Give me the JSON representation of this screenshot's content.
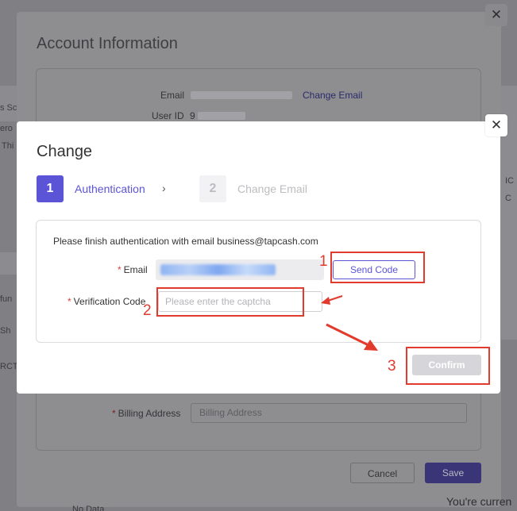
{
  "background": {
    "fragments": [
      "s Sc",
      "ero",
      "Thi",
      "fun",
      "Sh",
      "RCT",
      "IC",
      "C"
    ],
    "no_data": "No Data",
    "your_current": "You're curren"
  },
  "outer_modal": {
    "title": "Account Information",
    "email_label": "Email",
    "change_email": "Change Email",
    "user_id_label": "User ID",
    "user_id_prefix": "9",
    "billing_address_label": "Billing Address",
    "billing_address_placeholder": "Billing Address",
    "cancel": "Cancel",
    "save": "Save",
    "close": "✕"
  },
  "inner_modal": {
    "title": "Change",
    "close": "✕",
    "steps": [
      {
        "num": "1",
        "label": "Authentication"
      },
      {
        "num": "2",
        "label": "Change Email"
      }
    ],
    "chevron": "›",
    "auth_message": "Please finish authentication with email business@tapcash.com",
    "email_label": "Email",
    "send_code": "Send Code",
    "verification_label": "Verification Code",
    "captcha_placeholder": "Please enter the captcha",
    "confirm": "Confirm",
    "required_mark": "*"
  },
  "annotations": [
    "1",
    "2",
    "3"
  ],
  "colors": {
    "accent": "#5b54d6",
    "annotation": "#e23a2c",
    "required": "#e0413f",
    "disabled_button": "#d6d6da"
  }
}
